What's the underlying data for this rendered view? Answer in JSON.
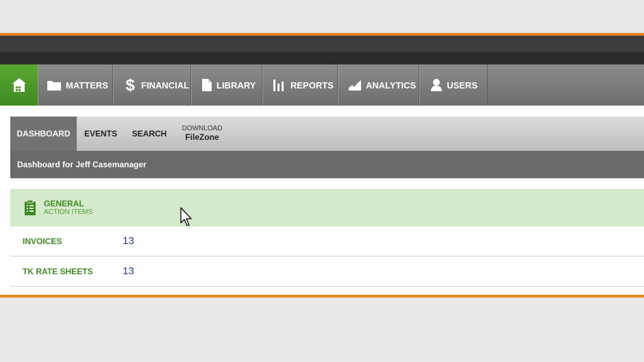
{
  "nav": {
    "items": [
      {
        "label": "MATTERS",
        "icon": "folder-icon"
      },
      {
        "label": "FINANCIAL",
        "icon": "dollar-icon"
      },
      {
        "label": "LIBRARY",
        "icon": "document-icon"
      },
      {
        "label": "REPORTS",
        "icon": "bar-chart-icon"
      },
      {
        "label": "ANALYTICS",
        "icon": "area-chart-icon"
      },
      {
        "label": "USERS",
        "icon": "user-icon"
      }
    ]
  },
  "subnav": {
    "dashboard": "DASHBOARD",
    "events": "EVENTS",
    "search": "SEARCH",
    "download_small": "DOWNLOAD",
    "download_big": "FileZone"
  },
  "page": {
    "title": "Dashboard for Jeff Casemanager"
  },
  "section": {
    "title": "GENERAL",
    "subtitle": "ACTION ITEMS",
    "rows": [
      {
        "label": "INVOICES",
        "count": "13"
      },
      {
        "label": "TK RATE SHEETS",
        "count": "13"
      }
    ]
  },
  "colors": {
    "accent_orange": "#e8891f",
    "home_green": "#4a9a2a",
    "section_bg": "#d5eacb",
    "count_blue": "#2a3a80"
  }
}
